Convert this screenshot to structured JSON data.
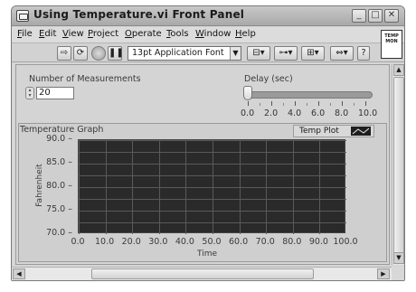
{
  "window": {
    "title": "Using Temperature.vi Front Panel"
  },
  "menubar": {
    "items": [
      "File",
      "Edit",
      "View",
      "Project",
      "Operate",
      "Tools",
      "Window",
      "Help"
    ]
  },
  "toolbar": {
    "font_select": "13pt Application Font",
    "icons": [
      "run-arrow-icon",
      "run-continuously-icon",
      "abort-icon",
      "pause-icon",
      "align-icon",
      "distribute-icon",
      "resize-icon",
      "reorder-icon",
      "help-icon"
    ]
  },
  "vi_icon": {
    "text": "TEMP MON"
  },
  "controls": {
    "num_measurements": {
      "label": "Number of Measurements",
      "value": "20"
    },
    "delay": {
      "label": "Delay (sec)",
      "value": 0.0,
      "scale": [
        "0.0",
        "2.0",
        "4.0",
        "6.0",
        "8.0",
        "10.0"
      ]
    }
  },
  "graph": {
    "title": "Temperature Graph",
    "legend": "Temp Plot",
    "colors": {
      "plot_bg": "#2a2a2a",
      "grid": "#5a5a5a",
      "frame": "#cfcfcf"
    }
  },
  "chart_data": {
    "type": "line",
    "title": "Temperature Graph",
    "xlabel": "Time",
    "ylabel": "Fahrenheit",
    "xlim": [
      0,
      100
    ],
    "ylim": [
      70,
      90
    ],
    "x_ticks": [
      "0.0",
      "10.0",
      "20.0",
      "30.0",
      "40.0",
      "50.0",
      "60.0",
      "70.0",
      "80.0",
      "90.0",
      "100.0"
    ],
    "y_ticks": [
      "90.0",
      "85.0",
      "80.0",
      "75.0",
      "70.0"
    ],
    "series": [
      {
        "name": "Temp Plot",
        "x": [],
        "y": []
      }
    ],
    "grid": true,
    "legend_position": "top-right"
  }
}
